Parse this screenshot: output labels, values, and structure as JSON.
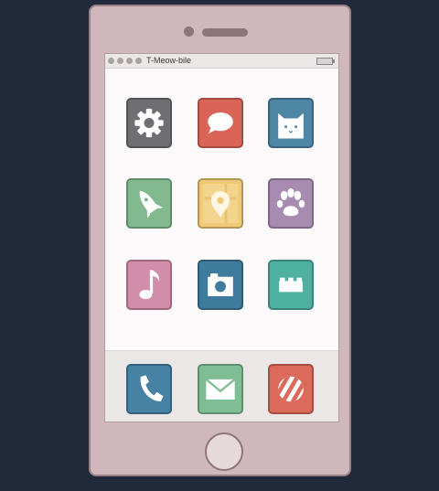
{
  "status_bar": {
    "carrier": "T-Meow-bile"
  },
  "colors": {
    "settings": "#6f6f73",
    "messages": "#db6458",
    "cat": "#4e86a6",
    "rocket": "#82b98f",
    "maps": "#efc978",
    "paw": "#a88bb1",
    "music": "#d18daa",
    "camera": "#3f7b9c",
    "lego": "#4fb2a1",
    "phone": "#4781a4",
    "mail": "#7fbd94",
    "candy": "#dc6a5b"
  },
  "apps": [
    {
      "icon": "gear-icon"
    },
    {
      "icon": "chat-bubble-icon"
    },
    {
      "icon": "cat-face-icon"
    },
    {
      "icon": "rocket-icon"
    },
    {
      "icon": "map-pin-icon"
    },
    {
      "icon": "paw-print-icon"
    },
    {
      "icon": "music-note-icon"
    },
    {
      "icon": "camera-icon"
    },
    {
      "icon": "lego-brick-icon"
    }
  ],
  "dock": [
    {
      "icon": "phone-handset-icon"
    },
    {
      "icon": "envelope-icon"
    },
    {
      "icon": "striped-ball-icon"
    }
  ]
}
